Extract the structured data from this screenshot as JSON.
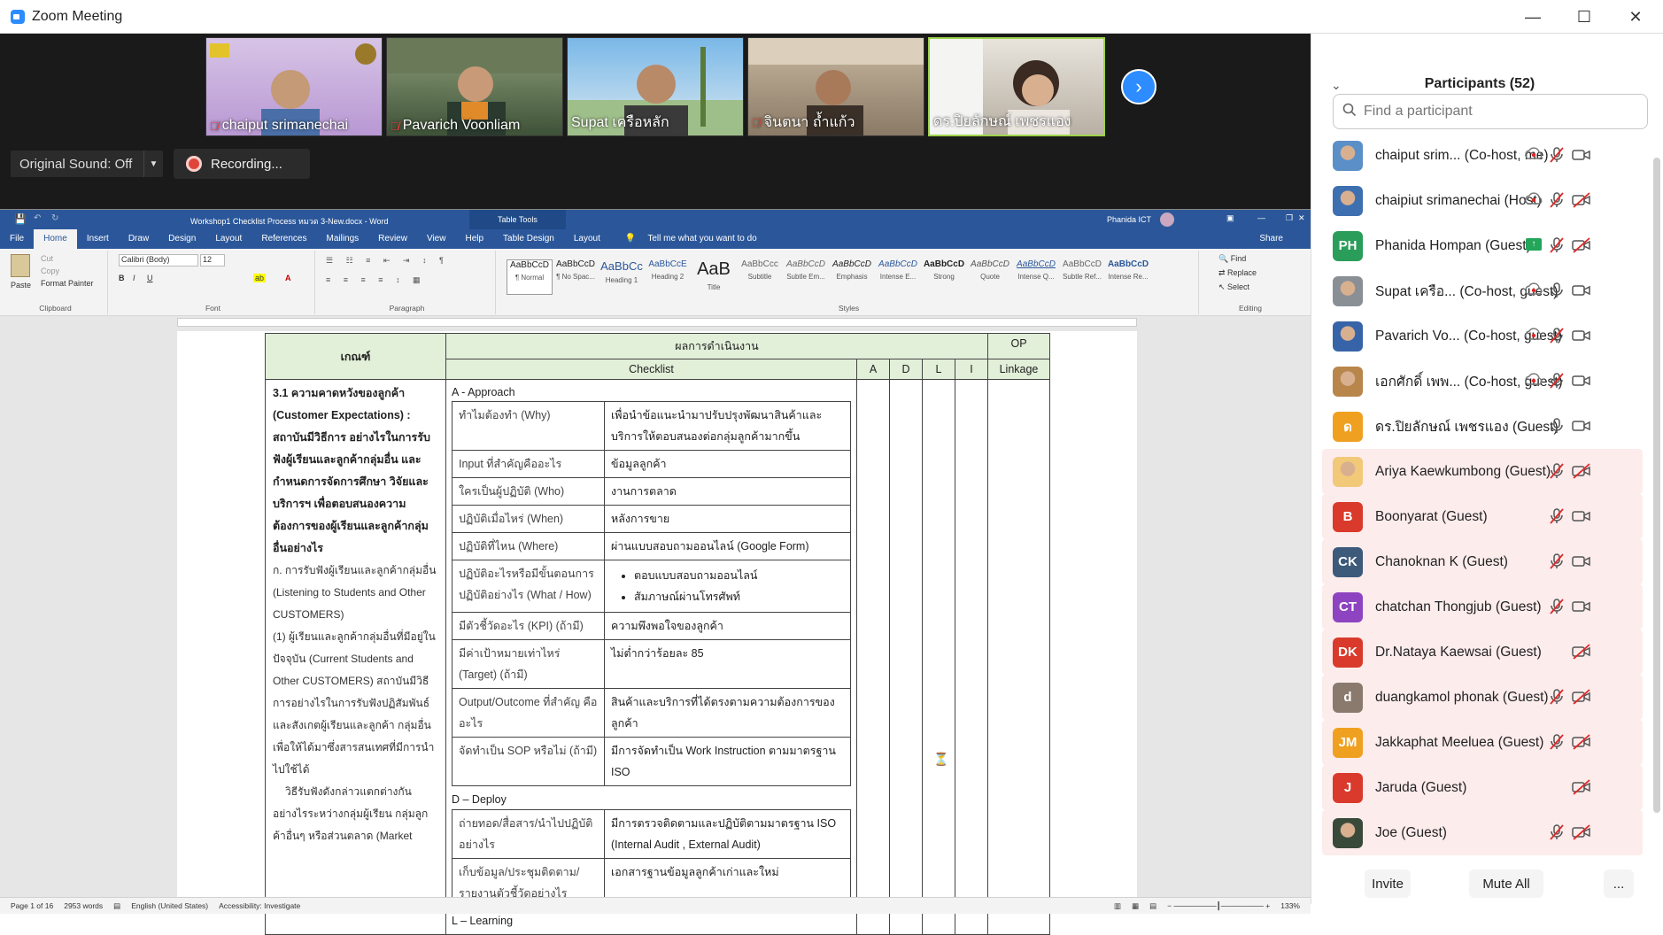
{
  "window": {
    "title": "Zoom Meeting"
  },
  "gallery": {
    "tiles": [
      {
        "name": "chaiput srimanechai",
        "muted": true
      },
      {
        "name": "Pavarich Voonliam",
        "muted": true
      },
      {
        "name": "Supat เครือหลัก",
        "muted": false
      },
      {
        "name": "จินตนา ถ้ำแก้ว",
        "muted": true
      },
      {
        "name": "ดร.ปิยลักษณ์ เพชรแอง",
        "muted": false
      }
    ]
  },
  "audio": {
    "original_sound": "Original Sound: Off"
  },
  "recording": {
    "label": "Recording..."
  },
  "word": {
    "doc_title": "Workshop1 Checklist Process หมวด 3-New.docx - Word",
    "table_tools": "Table Tools",
    "user": "Phanida ICT",
    "tabs": [
      "File",
      "Home",
      "Insert",
      "Draw",
      "Design",
      "Layout",
      "References",
      "Mailings",
      "Review",
      "View",
      "Help",
      "Table Design",
      "Layout"
    ],
    "tell_me": "Tell me what you want to do",
    "share": "Share",
    "clipboard": {
      "paste": "Paste",
      "cut": "Cut",
      "copy": "Copy",
      "format_painter": "Format Painter",
      "label": "Clipboard"
    },
    "font": {
      "name": "Calibri (Body)",
      "size": "12",
      "label": "Font"
    },
    "paragraph_label": "Paragraph",
    "styles": [
      {
        "sample": "AaBbCcD",
        "name": "¶ Normal"
      },
      {
        "sample": "AaBbCcD",
        "name": "¶ No Spac..."
      },
      {
        "sample": "AaBbCc",
        "name": "Heading 1"
      },
      {
        "sample": "AaBbCcE",
        "name": "Heading 2"
      },
      {
        "sample": "AaB",
        "name": "Title"
      },
      {
        "sample": "AaBbCcc",
        "name": "Subtitle"
      },
      {
        "sample": "AaBbCcD",
        "name": "Subtle Em..."
      },
      {
        "sample": "AaBbCcD",
        "name": "Emphasis"
      },
      {
        "sample": "AaBbCcD",
        "name": "Intense E..."
      },
      {
        "sample": "AaBbCcD",
        "name": "Strong"
      },
      {
        "sample": "AaBbCcD",
        "name": "Quote"
      },
      {
        "sample": "AaBbCcD",
        "name": "Intense Q..."
      },
      {
        "sample": "AaBbCcD",
        "name": "Subtle Ref..."
      },
      {
        "sample": "AaBbCcD",
        "name": "Intense Re..."
      }
    ],
    "styles_label": "Styles",
    "editing": {
      "find": "Find",
      "replace": "Replace",
      "select": "Select",
      "label": "Editing"
    },
    "status": {
      "page": "Page 1 of 16",
      "words": "2953 words",
      "lang": "English (United States)",
      "accessibility": "Accessibility: Investigate",
      "zoom": "133%"
    }
  },
  "doc_table": {
    "header": {
      "criteria": "เกณฑ์",
      "results": "ผลการดำเนินงาน",
      "checklist": "Checklist",
      "a": "A",
      "d": "D",
      "l": "L",
      "i": "I",
      "op": "OP",
      "linkage": "Linkage"
    },
    "criteria_bold": "3.1 ความคาดหวังของลูกค้า (Customer Expectations) : สถาบันมีวิธีการ อย่างไรในการรับฟังผู้เรียนและลูกค้ากลุ่มอื่น และกำหนดการจัดการศึกษา วิจัยและบริการฯ เพื่อตอบสนองความต้องการของผู้เรียนและลูกค้ากลุ่มอื่นอย่างไร",
    "criteria_a": "ก. การรับฟังผู้เรียนและลูกค้ากลุ่มอื่น (Listening to Students and Other CUSTOMERS)",
    "criteria_1": "(1) ผู้เรียนและลูกค้ากลุ่มอื่นที่มีอยู่ในปัจจุบัน (Current Students and Other CUSTOMERS) สถาบันมีวิธีการอย่างไรในการรับฟังปฏิสัมพันธ์และสังเกตผู้เรียนและลูกค้า กลุ่มอื่นเพื่อให้ได้มาซึ่งสารสนเทศที่มีการนำไปใช้ได้",
    "criteria_2": "วิธีรับฟังดังกล่าวแตกต่างกันอย่างไรระหว่างกลุ่มผู้เรียน กลุ่มลูกค้าอื่นๆ หรือส่วนตลาด (Market",
    "approach_title": "A - Approach",
    "approach_rows": [
      {
        "q": "ทำไมต้องทำ (Why)",
        "a": "เพื่อนำข้อแนะนำมาปรับปรุงพัฒนาสินค้าและบริการให้ตอบสนองต่อกลุ่มลูกค้ามากขึ้น"
      },
      {
        "q": "Input ที่สำคัญคืออะไร",
        "a": "ข้อมูลลูกค้า"
      },
      {
        "q": "ใครเป็นผู้ปฏิบัติ (Who)",
        "a": "งานการตลาด"
      },
      {
        "q": "ปฏิบัติเมื่อไหร่ (When)",
        "a": "หลังการขาย"
      },
      {
        "q": "ปฏิบัติที่ไหน (Where)",
        "a": "ผ่านแบบสอบถามออนไลน์ (Google Form)"
      },
      {
        "q": "ปฏิบัติอะไรหรือมีขั้นตอนการปฏิบัติอย่างไร (What / How)",
        "a": "",
        "bullets": [
          "ตอบแบบสอบถามออนไลน์",
          "สัมภาษณ์ผ่านโทรศัพท์"
        ]
      },
      {
        "q": "มีตัวชี้วัดอะไร (KPI) (ถ้ามี)",
        "a": "ความพึงพอใจของลูกค้า"
      },
      {
        "q": "มีค่าเป้าหมายเท่าไหร่ (Target) (ถ้ามี)",
        "a": "ไม่ต่ำกว่าร้อยละ 85"
      },
      {
        "q": "Output/Outcome ที่สำคัญ คืออะไร",
        "a": "สินค้าและบริการที่ได้ตรงตามความต้องการของลูกค้า"
      },
      {
        "q": "จัดทำเป็น SOP หรือไม่ (ถ้ามี)",
        "a": "มีการจัดทำเป็น Work Instruction ตามมาตรฐาน ISO"
      }
    ],
    "deploy_title": "D – Deploy",
    "deploy_rows": [
      {
        "q": "ถ่ายทอด/สื่อสาร/นำไปปฏิบัติอย่างไร",
        "a": "มีการตรวจติดตามและปฏิบัติตามมาตรฐาน ISO (Internal Audit , External Audit)"
      },
      {
        "q": "เก็บข้อมูล/ประชุมติดตาม/รายงานตัวชี้วัดอย่างไร",
        "a": "เอกสารฐานข้อมูลลูกค้าเก่าและใหม่"
      }
    ],
    "learning_title": "L – Learning"
  },
  "participants": {
    "title": "Participants (52)",
    "search_placeholder": "Find a participant",
    "list": [
      {
        "name": "chaiput srim...  (Co-host, me)",
        "initials": "",
        "color": "#5a8fc8",
        "photo": true,
        "mic": "muted",
        "video": "on",
        "hl": false,
        "rec": true
      },
      {
        "name": "chaipiut srimanechai (Host)",
        "initials": "",
        "color": "#3e6fb0",
        "photo": true,
        "mic": "muted",
        "video": "off",
        "hl": false,
        "rec": true
      },
      {
        "name": "Phanida Hompan (Guest)",
        "initials": "PH",
        "color": "#2a9d5b",
        "photo": false,
        "mic": "muted",
        "video": "off",
        "hl": false,
        "share": true
      },
      {
        "name": "Supat เครือ...  (Co-host, guest)",
        "initials": "",
        "color": "#8a8f96",
        "photo": true,
        "mic": "on",
        "video": "on",
        "hl": false,
        "rec": true
      },
      {
        "name": "Pavarich Vo...  (Co-host, guest)",
        "initials": "",
        "color": "#3764a8",
        "photo": true,
        "mic": "muted",
        "video": "on",
        "hl": false,
        "rec": true
      },
      {
        "name": "เอกศักดิ์  เพพ...  (Co-host, guest)",
        "initials": "",
        "color": "#b8864b",
        "photo": true,
        "mic": "muted",
        "video": "on",
        "hl": false,
        "rec": true
      },
      {
        "name": "ดร.ปิยลักษณ์ เพชรแอง (Guest)",
        "initials": "ด",
        "color": "#f0a020",
        "photo": false,
        "mic": "on",
        "video": "on",
        "hl": false
      },
      {
        "name": "Ariya Kaewkumbong (Guest)",
        "initials": "",
        "color": "#f2c879",
        "photo": true,
        "mic": "muted",
        "video": "off",
        "hl": true
      },
      {
        "name": "Boonyarat (Guest)",
        "initials": "B",
        "color": "#d93a2b",
        "photo": false,
        "mic": "muted",
        "video": "on",
        "hl": true
      },
      {
        "name": "Chanoknan K (Guest)",
        "initials": "CK",
        "color": "#3d5a7a",
        "photo": false,
        "mic": "muted",
        "video": "on",
        "hl": true
      },
      {
        "name": "chatchan Thongjub (Guest)",
        "initials": "CT",
        "color": "#8e44c0",
        "photo": false,
        "mic": "muted",
        "video": "on",
        "hl": true
      },
      {
        "name": "Dr.Nataya Kaewsai (Guest)",
        "initials": "DK",
        "color": "#d93a2b",
        "photo": false,
        "mic": "none",
        "video": "off",
        "hl": true
      },
      {
        "name": "duangkamol phonak (Guest)",
        "initials": "d",
        "color": "#8a7a6e",
        "photo": false,
        "mic": "muted",
        "video": "off",
        "hl": true
      },
      {
        "name": "Jakkaphat Meeluea (Guest)",
        "initials": "JM",
        "color": "#f0a020",
        "photo": false,
        "mic": "muted",
        "video": "off",
        "hl": true
      },
      {
        "name": "Jaruda (Guest)",
        "initials": "J",
        "color": "#d93a2b",
        "photo": false,
        "mic": "none",
        "video": "off",
        "hl": true
      },
      {
        "name": "Joe (Guest)",
        "initials": "",
        "color": "#3a4a3a",
        "photo": true,
        "mic": "muted",
        "video": "off",
        "hl": true
      }
    ],
    "invite": "Invite",
    "mute_all": "Mute All",
    "more": "..."
  }
}
